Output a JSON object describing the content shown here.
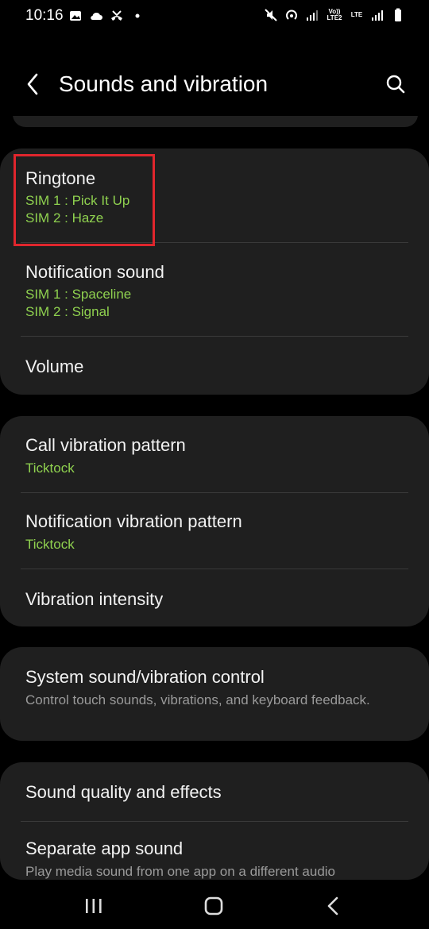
{
  "status_bar": {
    "time": "10:16",
    "left_icons": [
      "gallery-icon",
      "cloud-icon",
      "missed-call-icon",
      "dot-icon"
    ],
    "right_icons": [
      "mute-icon",
      "hotspot-icon",
      "signal-icon",
      "volte-lte2-icon",
      "lte-icon",
      "signal-icon",
      "battery-icon"
    ],
    "volte_label": "Vo)) LTE2",
    "lte_label": "LTE"
  },
  "header": {
    "title": "Sounds and vibration"
  },
  "groups": [
    {
      "items": [
        {
          "title": "Ringtone",
          "sub1": "SIM 1 : Pick It Up",
          "sub2": "SIM 2 : Haze"
        },
        {
          "title": "Notification sound",
          "sub1": "SIM 1 : Spaceline",
          "sub2": "SIM 2 : Signal"
        },
        {
          "title": "Volume"
        }
      ]
    },
    {
      "items": [
        {
          "title": "Call vibration pattern",
          "sub1": "Ticktock"
        },
        {
          "title": "Notification vibration pattern",
          "sub1": "Ticktock"
        },
        {
          "title": "Vibration intensity"
        }
      ]
    },
    {
      "items": [
        {
          "title": "System sound/vibration control",
          "desc": "Control touch sounds, vibrations, and keyboard feedback."
        }
      ]
    },
    {
      "items": [
        {
          "title": "Sound quality and effects"
        },
        {
          "title": "Separate app sound",
          "desc": "Play media sound from one app on a different audio"
        }
      ]
    }
  ],
  "colors": {
    "accent_green": "#8fd14f",
    "card_bg": "#1f1f1f",
    "highlight_red": "#e0262d"
  },
  "nav_bar": {
    "buttons": [
      "recents-icon",
      "home-icon",
      "back-icon"
    ]
  }
}
